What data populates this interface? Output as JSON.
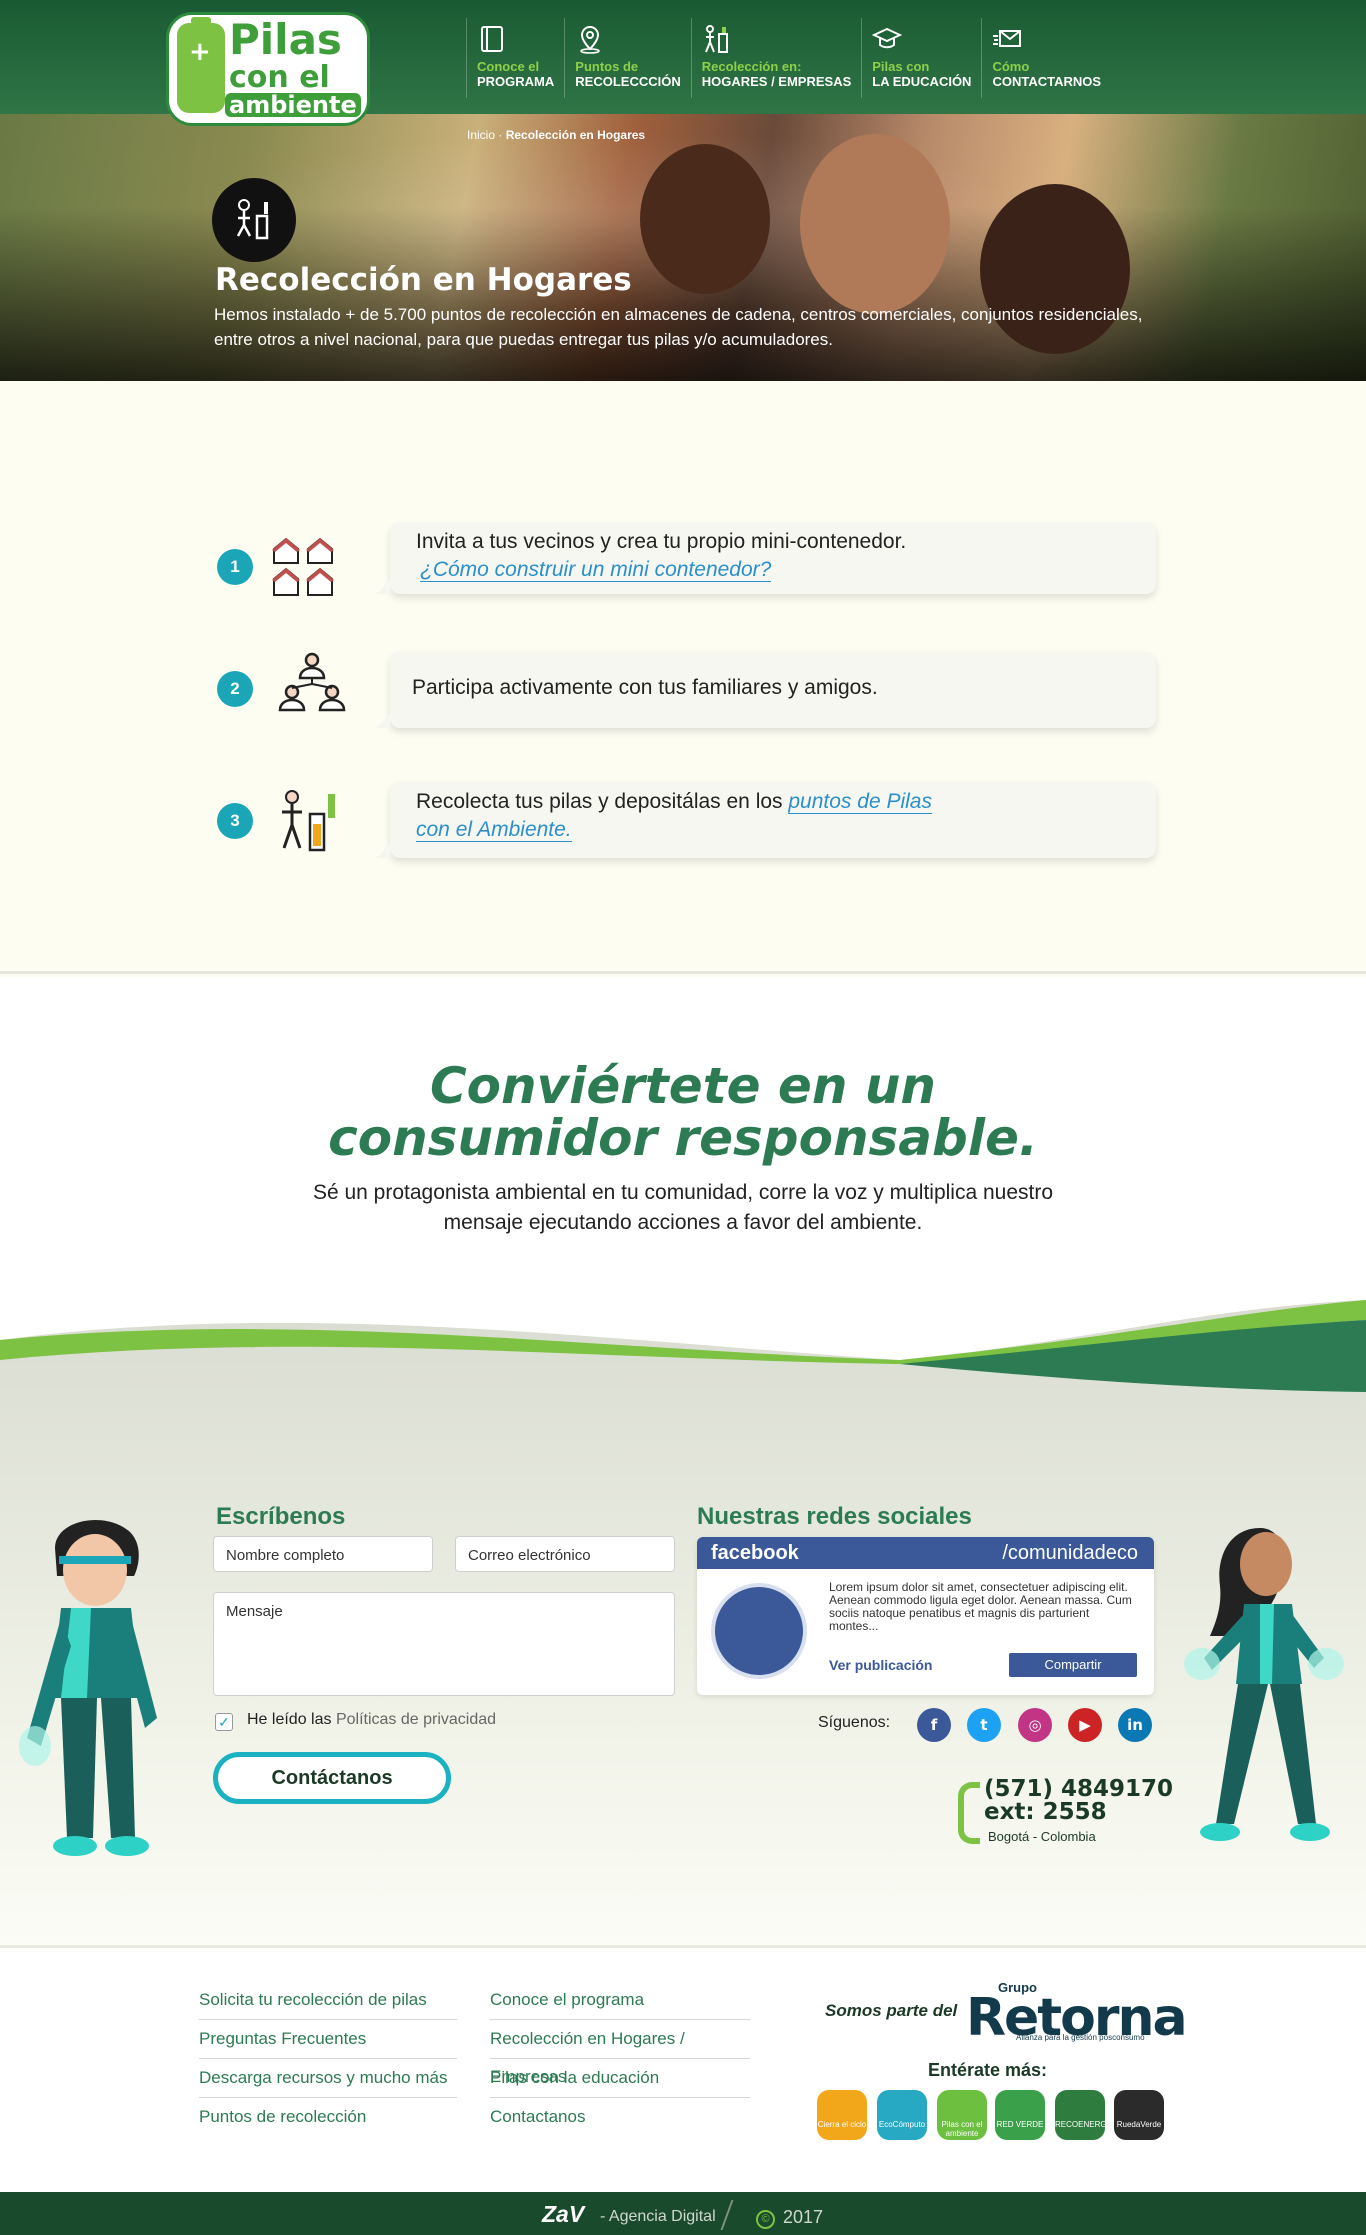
{
  "header": {
    "logo": {
      "line1": "Pilas",
      "line2": "con el",
      "line3": "ambiente"
    },
    "nav": [
      {
        "line1": "Conoce el",
        "line2": "PROGRAMA",
        "icon": "book-icon"
      },
      {
        "line1": "Puntos de",
        "line2": "RECOLECCCIÓN",
        "icon": "map-pin-icon"
      },
      {
        "line1": "Recolección en:",
        "line2": "HOGARES / EMPRESAS",
        "icon": "battery-bin-icon"
      },
      {
        "line1": "Pilas con",
        "line2": "LA EDUCACIÓN",
        "icon": "graduation-cap-icon"
      },
      {
        "line1": "Cómo",
        "line2": "CONTACTARNOS",
        "icon": "envelope-icon"
      }
    ]
  },
  "breadcrumb": {
    "home": "Inicio",
    "separator": "·",
    "current": "Recolección en Hogares"
  },
  "hero": {
    "title": "Recolección en  Hogares",
    "text": "Hemos instalado + de 5.700 puntos de recolección en almacenes de cadena, centros comerciales, conjuntos residenciales, entre otros a nivel nacional, para que puedas entregar tus pilas y/o acumuladores."
  },
  "steps": [
    {
      "num": "1",
      "text": "Invita a tus vecinos y crea tu propio mini-contenedor.",
      "link": "¿Cómo construir un mini contenedor?",
      "icon": "houses-icon"
    },
    {
      "num": "2",
      "text": "Participa activamente con tus familiares y amigos.",
      "icon": "people-network-icon"
    },
    {
      "num": "3",
      "text": "Recolecta tus pilas y depositálas en los ",
      "link": "puntos de Pilas con el Ambiente.",
      "icon": "person-recycle-bin-icon"
    }
  ],
  "consumer": {
    "title_line1": "Conviértete en un",
    "title_line2": "consumidor responsable.",
    "text": "Sé un protagonista ambiental en tu comunidad, corre la voz y multiplica nuestro mensaje ejecutando acciones a favor del ambiente."
  },
  "contact_form": {
    "heading": "Escríbenos",
    "name_placeholder": "Nombre completo",
    "email_placeholder": "Correo electrónico",
    "message_placeholder": "Mensaje",
    "checkbox_prefix": "He leído las",
    "checkbox_link": "Políticas de privacidad",
    "checkbox_checked": true,
    "submit_label": "Contáctanos"
  },
  "social": {
    "heading": "Nuestras redes sociales",
    "fb_logo": "facebook",
    "fb_page": "/comunidadeco",
    "fb_post": "Lorem ipsum dolor sit amet, consectetuer adipiscing elit. Aenean commodo ligula eget dolor. Aenean massa. Cum sociis natoque penatibus et magnis dis parturient montes...",
    "fb_view": "Ver publicación",
    "fb_share": "Compartir",
    "follow_label": "Síguenos:",
    "networks": [
      {
        "name": "facebook-icon",
        "glyph": "f",
        "color": "#3b5998"
      },
      {
        "name": "twitter-icon",
        "glyph": "t",
        "color": "#1da1f2"
      },
      {
        "name": "instagram-icon",
        "glyph": "◎",
        "color": "#c13584"
      },
      {
        "name": "youtube-icon",
        "glyph": "▶",
        "color": "#cc2424"
      },
      {
        "name": "linkedin-icon",
        "glyph": "in",
        "color": "#0a78b5"
      }
    ],
    "phone": "(571) 4849170",
    "ext": "ext: 2558",
    "city": "Bogotá - Colombia"
  },
  "footer": {
    "col1": [
      "Solicita tu recolección de pilas",
      "Preguntas Frecuentes",
      "Descarga recursos y mucho más",
      "Puntos de recolección"
    ],
    "col2": [
      "Conoce el programa",
      "Recolección en Hogares / Empresas",
      "Pilas con la educación",
      "Contactanos"
    ],
    "somos": "Somos parte del",
    "grupo": "Grupo",
    "retorna": "Retorna",
    "retorna_sub": "Alianza para la gestión posconsumo",
    "enterate": "Entérate más:",
    "programs": [
      {
        "name": "cierra-el-ciclo-logo",
        "label": "Cierra el ciclo",
        "color": "#f2a71b"
      },
      {
        "name": "ecocomputo-logo",
        "label": "EcoCómputo",
        "color": "#27a9c4"
      },
      {
        "name": "pilas-con-el-ambiente-logo",
        "label": "Pilas con el ambiente",
        "color": "#6cbf3f"
      },
      {
        "name": "red-verde-logo",
        "label": "RED VERDE",
        "color": "#3aa14a"
      },
      {
        "name": "recoenergy-logo",
        "label": "RECOENERGY",
        "color": "#2e7d3e"
      },
      {
        "name": "rueda-verde-logo",
        "label": "RuedaVerde",
        "color": "#2b2b2b"
      }
    ]
  },
  "bottom": {
    "brand": "ZaV",
    "agency": "- Agencia Digital",
    "copy": "©",
    "year": "2017"
  }
}
